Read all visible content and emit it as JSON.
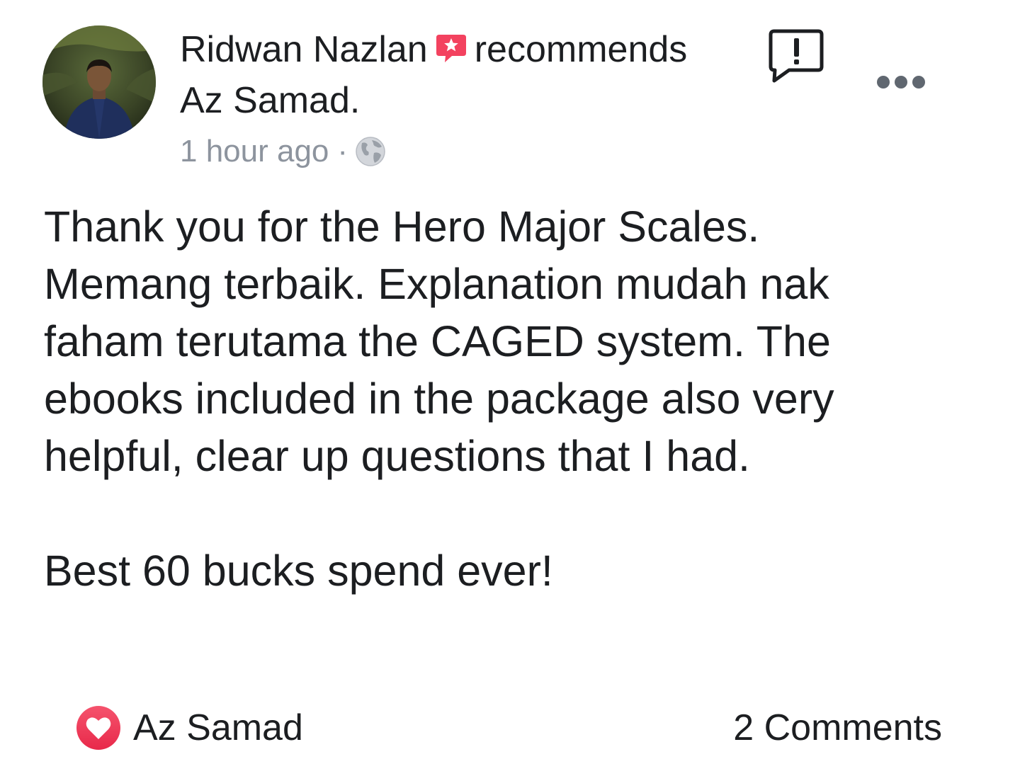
{
  "post": {
    "author": "Ridwan Nazlan",
    "action": "recommends",
    "page_name": "Az Samad.",
    "timestamp": "1 hour ago",
    "separator": "·",
    "privacy_icon": "globe-icon",
    "body_paragraphs": [
      "Thank you for the Hero Major Scales. Memang terbaik. Explanation mudah nak faham terutama the CAGED system. The ebooks included in the package also very helpful, clear up questions that I had.",
      "Best 60 bucks spend ever!"
    ]
  },
  "footer": {
    "reaction_icon": "heart-icon",
    "reactor": "Az Samad",
    "comments": "2 Comments"
  },
  "icons": {
    "recommend": "recommend-badge-icon",
    "report": "report-icon",
    "more": "more-options-icon"
  },
  "colors": {
    "text": "#1c1e21",
    "meta": "#8d949e",
    "recommend_badge": "#f3425f",
    "heart": "#f33e58"
  }
}
